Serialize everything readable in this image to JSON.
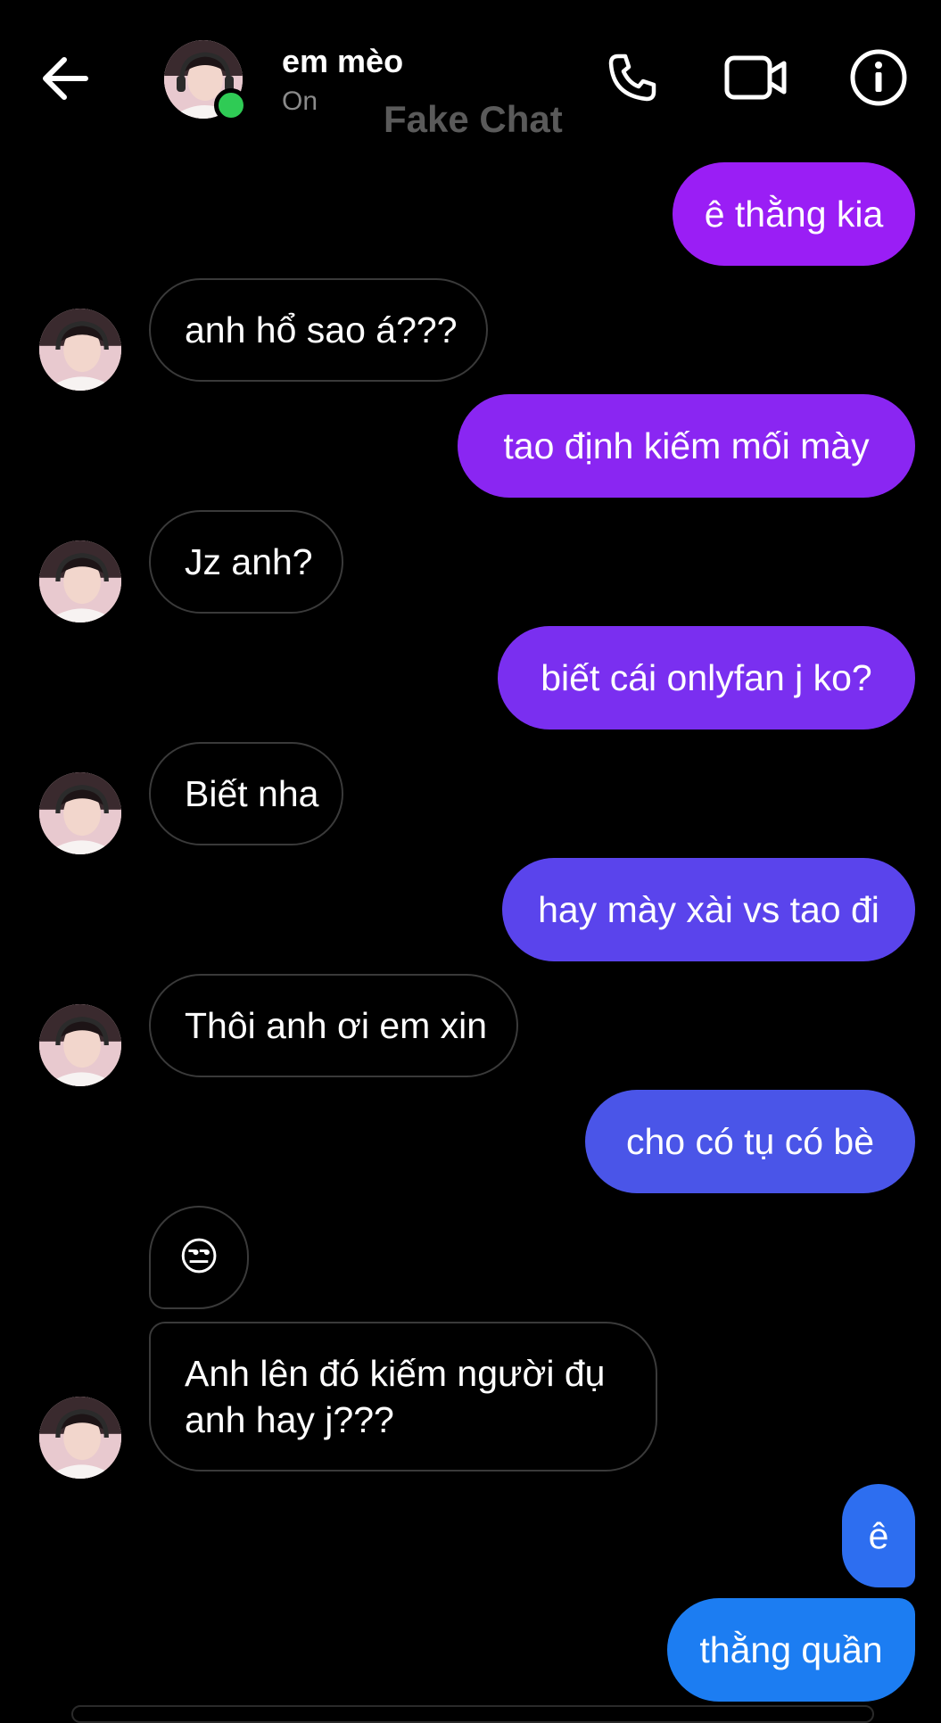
{
  "header": {
    "contact_name": "em mèo",
    "status": "On",
    "watermark": "Fake Chat",
    "status_color": "#2fcb55"
  },
  "icons": {
    "back": "arrow-left-icon",
    "call": "phone-icon",
    "video": "video-camera-icon",
    "info": "info-icon"
  },
  "colors": {
    "background": "#000000",
    "incoming_border": "#3a3a3a",
    "outgoing_gradient": [
      "#9a1ef5",
      "#7a2ff0",
      "#5a44ec",
      "#4a55e8",
      "#2d6ef0",
      "#1c7df2"
    ]
  },
  "messages": [
    {
      "side": "out",
      "text": "ê thằng kia"
    },
    {
      "side": "in",
      "text": "anh hổ sao á???"
    },
    {
      "side": "out",
      "text": "tao định kiếm mối mày"
    },
    {
      "side": "in",
      "text": "Jz anh?"
    },
    {
      "side": "out",
      "text": "biết cái onlyfan j ko?"
    },
    {
      "side": "in",
      "text": "Biết nha"
    },
    {
      "side": "out",
      "text": "hay mày xài vs tao đi"
    },
    {
      "side": "in",
      "text": "Thôi anh ơi em xin"
    },
    {
      "side": "out",
      "text": "cho có tụ có bè"
    },
    {
      "side": "in",
      "text": "😒"
    },
    {
      "side": "in",
      "text": "Anh lên đó kiếm người đụ anh hay j???"
    },
    {
      "side": "out",
      "text": "ê"
    },
    {
      "side": "out",
      "text": "thằng quần"
    }
  ]
}
